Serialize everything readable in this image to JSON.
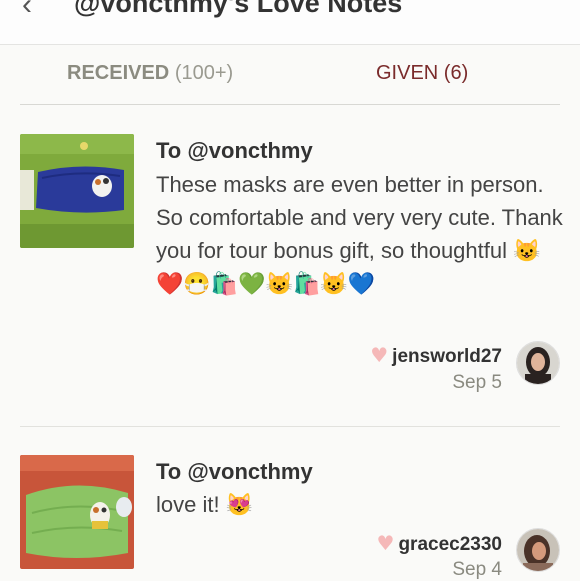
{
  "header": {
    "back_icon": "chevron-left-icon",
    "title": "@voncthmy's Love Notes"
  },
  "tabs": [
    {
      "label": "RECEIVED",
      "count": "(100+)"
    },
    {
      "label": "GIVEN (6)"
    }
  ],
  "notes": [
    {
      "to": "To @voncthmy",
      "text": "These masks are even better in person. So comfortable and very very cute. Thank you for tour bonus gift, so thoughtful 😺❤️😷🛍️💚😺🛍️😺💙",
      "username": "jensworld27",
      "date": "Sep 5"
    },
    {
      "to": "To @voncthmy",
      "text": "love it! 😻",
      "username": "gracec2330",
      "date": "Sep 4"
    }
  ],
  "colors": {
    "given_tab": "#7a2b2b",
    "received_tab": "#8b8b80",
    "heart": "#f5b8b8"
  }
}
